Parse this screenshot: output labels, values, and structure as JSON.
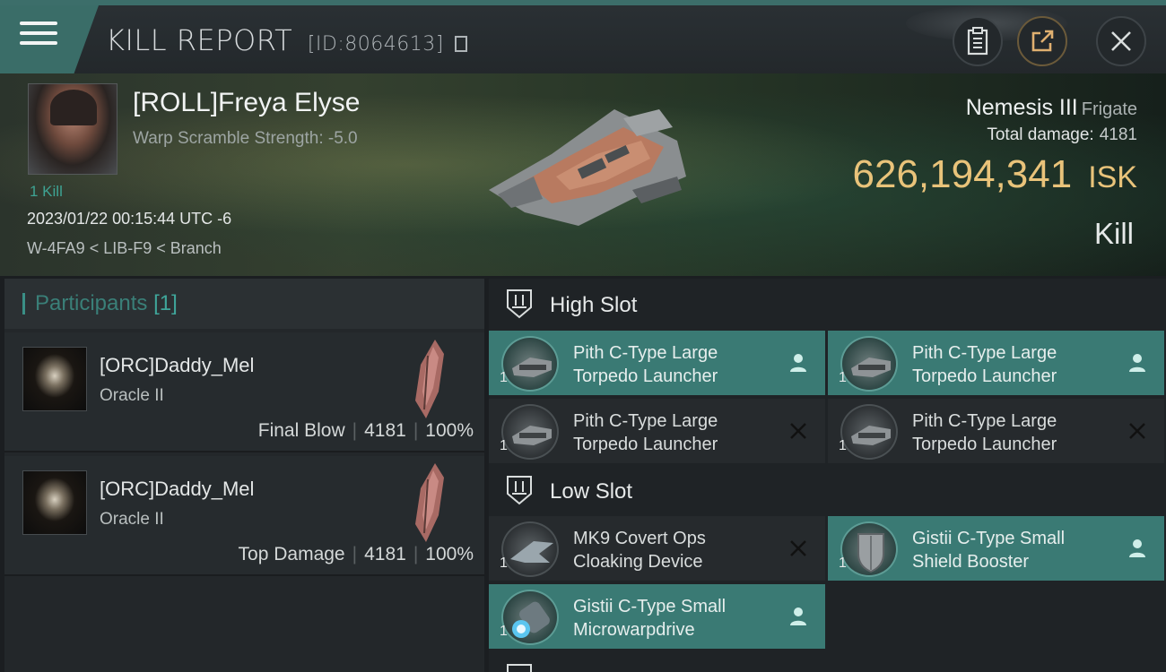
{
  "header": {
    "title": "KILL REPORT",
    "report_id": "[ID:8064613]",
    "buttons": [
      {
        "name": "report-icon"
      },
      {
        "name": "share-icon"
      },
      {
        "name": "close-icon"
      }
    ]
  },
  "victim": {
    "name": "[ROLL]Freya Elyse",
    "warp_scramble": "Warp Scramble Strength: -5.0",
    "kill_count": "1 Kill",
    "datetime": "2023/01/22 00:15:44 UTC -6",
    "location": "W-4FA9 < LIB-F9 < Branch"
  },
  "ship": {
    "name": "Nemesis III",
    "class": "Frigate",
    "total_damage_label": "Total damage:",
    "total_damage": "4181",
    "isk_value": "626,194,341",
    "isk_unit": "ISK",
    "result": "Kill"
  },
  "participants": {
    "label": "Participants",
    "count": "[1]",
    "list": [
      {
        "name": "[ORC]Daddy_Mel",
        "ship": "Oracle II",
        "role": "Final Blow",
        "damage": "4181",
        "percent": "100%"
      },
      {
        "name": "[ORC]Daddy_Mel",
        "ship": "Oracle II",
        "role": "Top Damage",
        "damage": "4181",
        "percent": "100%"
      }
    ]
  },
  "slots": {
    "high": {
      "title": "High Slot",
      "items": [
        {
          "name_line1": "Pith C-Type Large",
          "name_line2": "Torpedo Launcher",
          "qty": "1",
          "status": "dropped"
        },
        {
          "name_line1": "Pith C-Type Large",
          "name_line2": "Torpedo Launcher",
          "qty": "1",
          "status": "dropped"
        },
        {
          "name_line1": "Pith C-Type Large",
          "name_line2": "Torpedo Launcher",
          "qty": "1",
          "status": "destroyed"
        },
        {
          "name_line1": "Pith C-Type Large",
          "name_line2": "Torpedo Launcher",
          "qty": "1",
          "status": "destroyed"
        }
      ]
    },
    "low": {
      "title": "Low Slot",
      "items": [
        {
          "name_line1": "MK9 Covert Ops",
          "name_line2": "Cloaking Device",
          "qty": "1",
          "status": "destroyed"
        },
        {
          "name_line1": "Gistii C-Type Small",
          "name_line2": "Shield Booster",
          "qty": "1",
          "status": "dropped"
        },
        {
          "name_line1": "Gistii C-Type Small",
          "name_line2": "Microwarpdrive",
          "qty": "1",
          "status": "dropped"
        }
      ]
    }
  },
  "colors": {
    "accent": "#3a7a74",
    "isk": "#e9c37a",
    "kill_count": "#3ea393"
  }
}
